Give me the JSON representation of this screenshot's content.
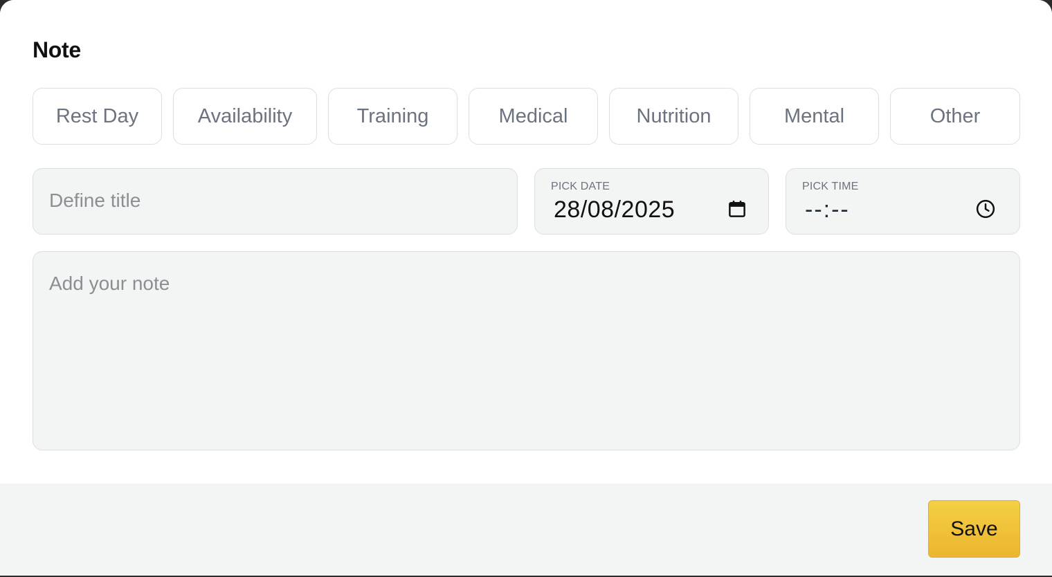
{
  "modal": {
    "title": "Note"
  },
  "categories": [
    {
      "label": "Rest Day"
    },
    {
      "label": "Availability"
    },
    {
      "label": "Training"
    },
    {
      "label": "Medical"
    },
    {
      "label": "Nutrition"
    },
    {
      "label": "Mental"
    },
    {
      "label": "Other"
    }
  ],
  "fields": {
    "title": {
      "placeholder": "Define title"
    },
    "date": {
      "label": "PICK DATE",
      "value": "28/08/2025",
      "icon": "calendar-icon"
    },
    "time": {
      "label": "PICK TIME",
      "value": "--:--",
      "icon": "clock-icon"
    },
    "note": {
      "placeholder": "Add your note"
    }
  },
  "footer": {
    "save_label": "Save"
  },
  "colors": {
    "accent": "#f2c53d",
    "field_bg": "#f3f5f4",
    "chip_text": "#6b7280"
  }
}
